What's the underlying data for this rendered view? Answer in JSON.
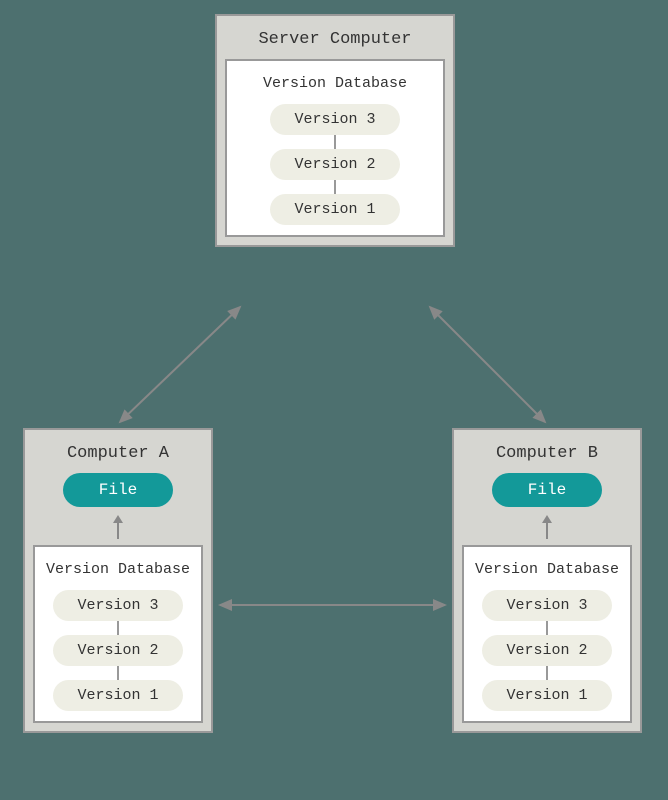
{
  "server": {
    "title": "Server Computer",
    "db_title": "Version Database",
    "versions": [
      "Version 3",
      "Version 2",
      "Version 1"
    ]
  },
  "computer_a": {
    "title": "Computer A",
    "file_label": "File",
    "db_title": "Version Database",
    "versions": [
      "Version 3",
      "Version 2",
      "Version 1"
    ]
  },
  "computer_b": {
    "title": "Computer B",
    "file_label": "File",
    "db_title": "Version Database",
    "versions": [
      "Version 3",
      "Version 2",
      "Version 1"
    ]
  }
}
